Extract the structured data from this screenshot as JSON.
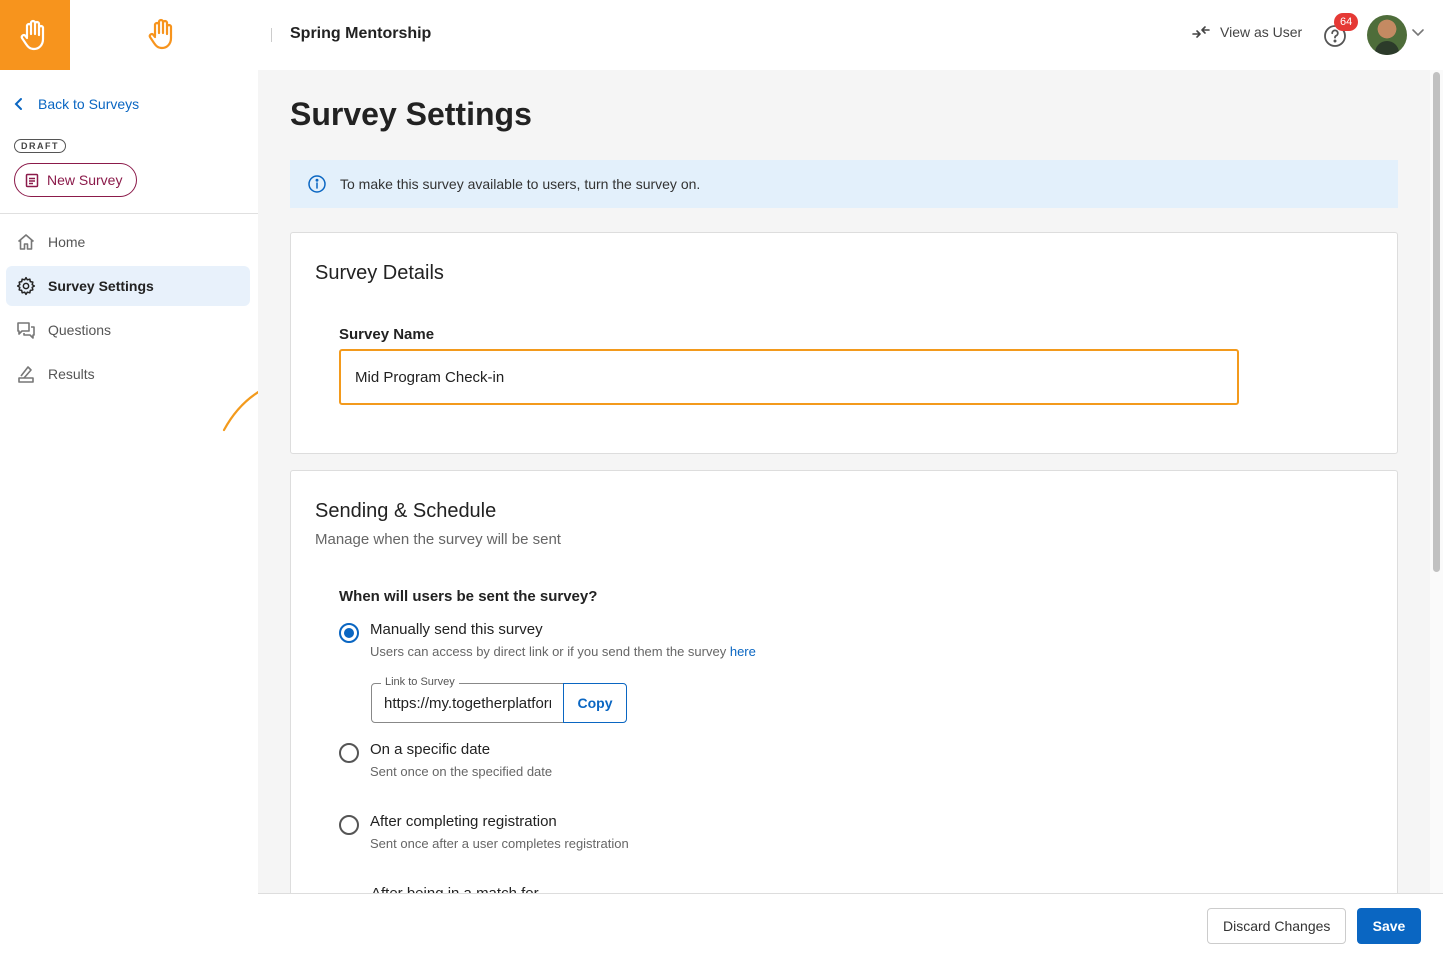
{
  "header": {
    "program_title": "Spring Mentorship",
    "view_as_user": "View as User",
    "notification_count": "64",
    "brand_color": "#f7941d"
  },
  "sidebar": {
    "back_label": "Back to Surveys",
    "status_badge": "DRAFT",
    "survey_title": "New Survey",
    "items": [
      {
        "label": "Home",
        "icon": "home-icon",
        "active": false
      },
      {
        "label": "Survey Settings",
        "icon": "gear-icon",
        "active": true
      },
      {
        "label": "Questions",
        "icon": "questions-icon",
        "active": false
      },
      {
        "label": "Results",
        "icon": "results-icon",
        "active": false
      }
    ]
  },
  "main": {
    "page_title": "Survey Settings",
    "info_banner": "To make this survey available to users, turn the survey on.",
    "details": {
      "title": "Survey Details",
      "name_label": "Survey Name",
      "name_value": "Mid Program Check-in"
    },
    "schedule": {
      "title": "Sending & Schedule",
      "subtitle": "Manage when the survey will be sent",
      "question": "When will users be sent the survey?",
      "options": [
        {
          "title": "Manually send this survey",
          "desc": "Users can access by direct link or if you send them the survey",
          "link_text": "here",
          "checked": true
        },
        {
          "title": "On a specific date",
          "desc": "Sent once on the specified date",
          "checked": false
        },
        {
          "title": "After completing registration",
          "desc": "Sent once after a user completes registration",
          "checked": false
        },
        {
          "title": "After being in a match for",
          "checked": false
        }
      ],
      "link_field_label": "Link to Survey",
      "link_value": "https://my.togetherplatform.com",
      "copy_label": "Copy"
    }
  },
  "footer": {
    "discard_label": "Discard Changes",
    "save_label": "Save"
  },
  "colors": {
    "accent": "#0a66c2",
    "highlight": "#f39a1c",
    "survey_badge": "#8b1a4a"
  }
}
